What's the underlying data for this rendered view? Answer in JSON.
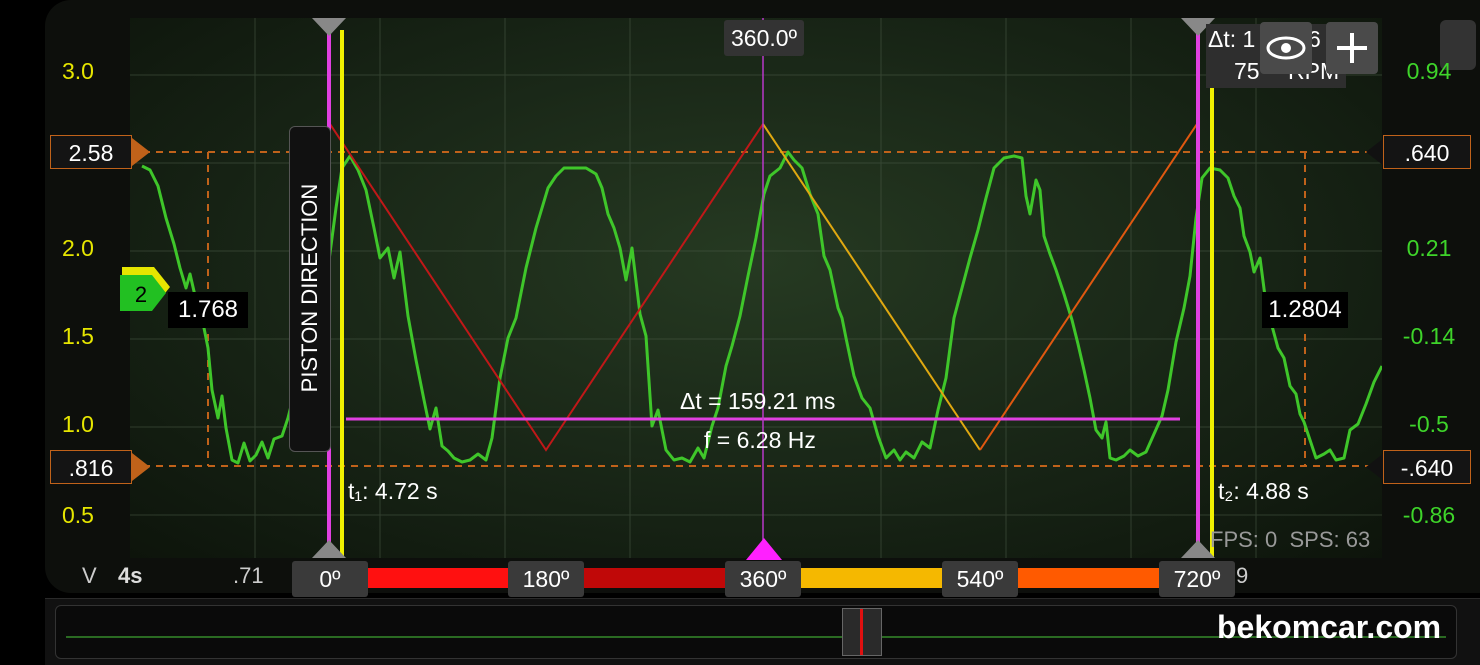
{
  "left_axis": {
    "unit": "V",
    "ticks": [
      "3.0",
      "2.0",
      "1.5",
      "1.0",
      "0.5"
    ]
  },
  "right_axis": {
    "ticks": [
      "0.94",
      "0.21",
      "-0.14",
      "-0.5",
      "-0.86"
    ]
  },
  "upper_marker": {
    "left": "2.58",
    "right": ".640"
  },
  "lower_marker": {
    "left": ".816",
    "right": "-.640"
  },
  "channel": {
    "number": "2",
    "value": "1.768"
  },
  "right_value": "1.2804",
  "piston_label": "PISTON DIRECTION",
  "angle_top": "360.0º",
  "delta_box": {
    "line1": "Δt: 1",
    "line1b": "6",
    "line2": "75",
    "line2b": "RPM"
  },
  "delta_t": "Δt = 159.21 ms",
  "freq": "f = 6.28 Hz",
  "t1": "t₁: 4.72 s",
  "t2": "t₂: 4.88 s",
  "fps": "FPS: 0  SPS: 63",
  "time_axis": {
    "scale": "4s",
    "tick1": ".71",
    "tick_partial": "9"
  },
  "angles": [
    "0º",
    "180º",
    "360º",
    "540º",
    "720º"
  ],
  "watermark": "bekomcar.com",
  "colors": {
    "trace": "#3fc62a",
    "cursor_magenta": "#e040e0",
    "cursor_yellow": "#f0f000",
    "marker": "#c0621a"
  }
}
